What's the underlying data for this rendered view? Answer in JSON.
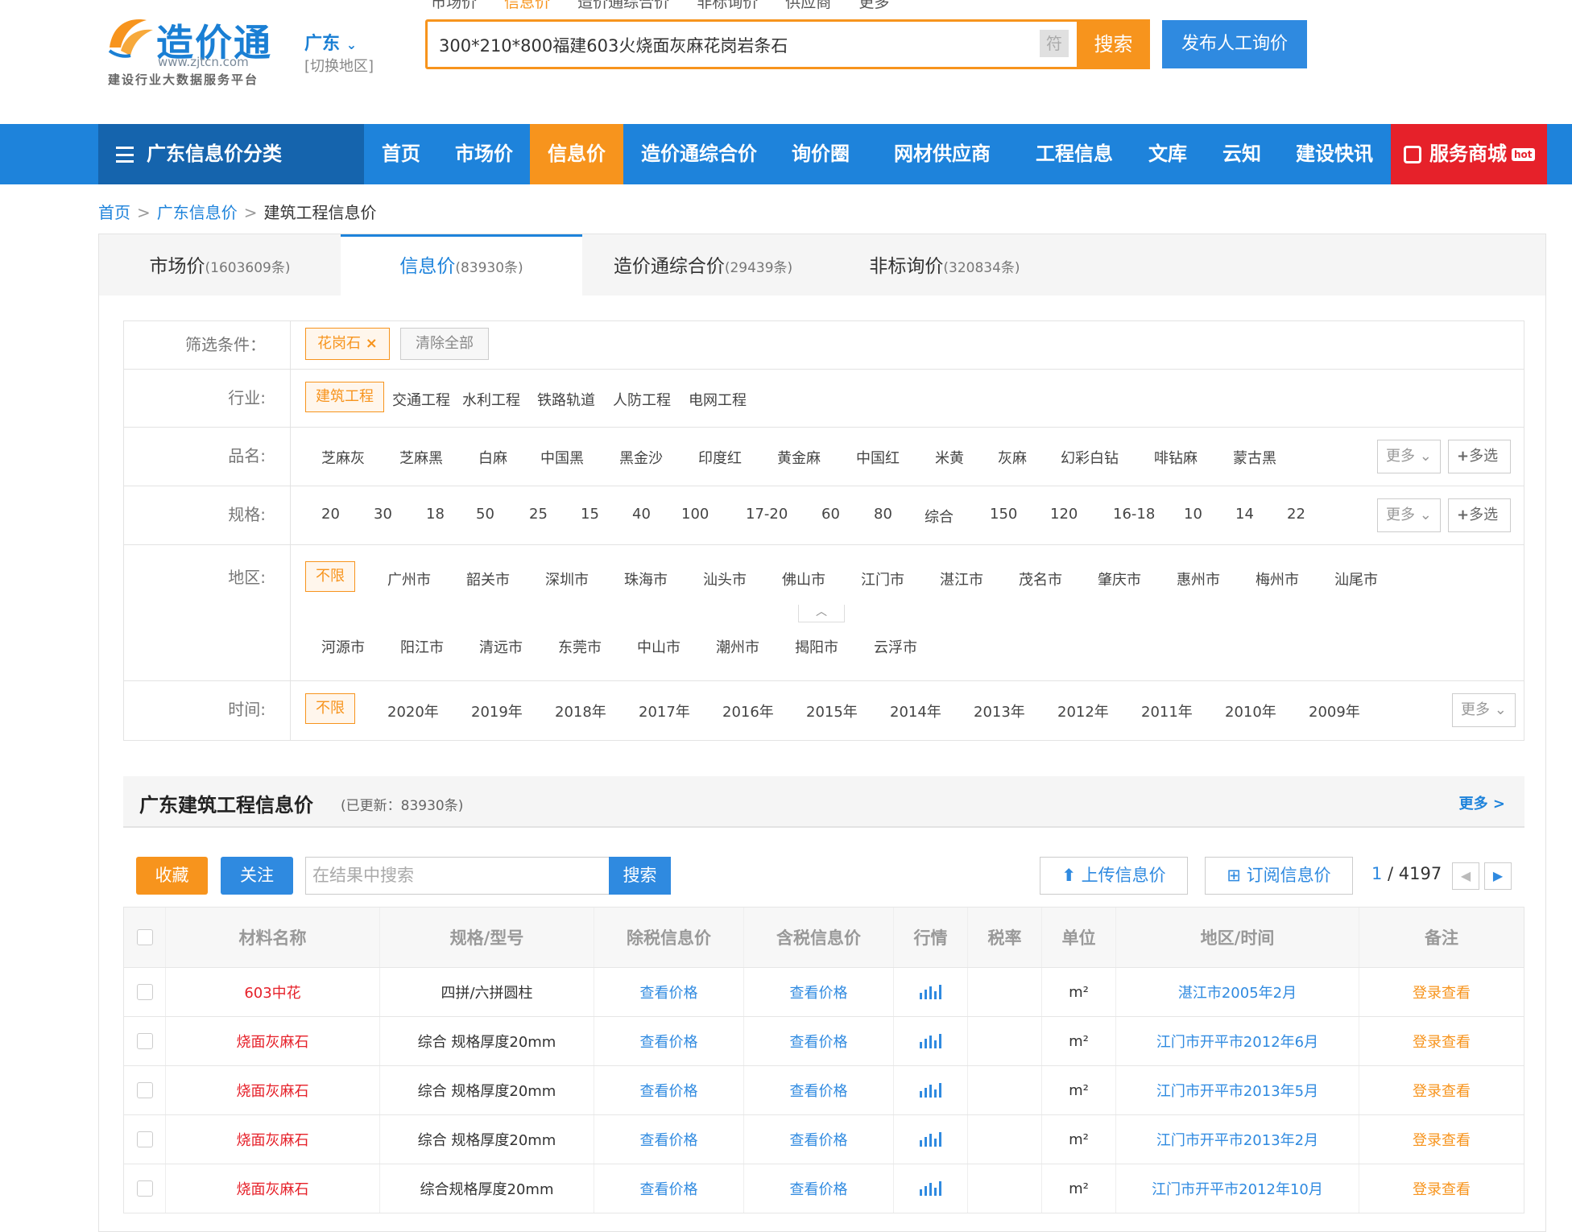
{
  "header": {
    "logo_name": "造价通",
    "logo_url": "www.zjtcn.com",
    "logo_slogan": "建设行业大数据服务平台",
    "region": "广东",
    "region_switch": "[切换地区]",
    "top_links": [
      "市场价",
      "信息价",
      "造价通综合价",
      "非标询价",
      "供应商",
      "更多"
    ],
    "search_query": "300*210*800福建603火烧面灰麻花岗岩条石",
    "symbol_label": "符",
    "search_button": "搜索",
    "publish_button": "发布人工询价"
  },
  "navbar": {
    "category": "广东信息价分类",
    "items": [
      "首页",
      "市场价",
      "信息价",
      "造价通综合价",
      "询价圈",
      "网材供应商",
      "工程信息",
      "文库",
      "云知",
      "建设快讯"
    ],
    "shop": "服务商城",
    "shop_badge": "hot"
  },
  "breadcrumb": [
    "首页",
    "广东信息价",
    "建筑工程信息价"
  ],
  "tabs": [
    {
      "label": "市场价",
      "count": "(1603609条)"
    },
    {
      "label": "信息价",
      "count": "(83930条)"
    },
    {
      "label": "造价通综合价",
      "count": "(29439条)"
    },
    {
      "label": "非标询价",
      "count": "(320834条)"
    }
  ],
  "filters": {
    "condition_label": "筛选条件：",
    "active_tag": "花岗石",
    "clear_all": "清除全部",
    "industry_label": "行业:",
    "industry": [
      "建筑工程",
      "交通工程",
      "水利工程",
      "铁路轨道",
      "人防工程",
      "电网工程"
    ],
    "name_label": "品名:",
    "names": [
      "芝麻灰",
      "芝麻黑",
      "白麻",
      "中国黑",
      "黑金沙",
      "印度红",
      "黄金麻",
      "中国红",
      "米黄",
      "灰麻",
      "幻彩白钻",
      "啡钻麻",
      "蒙古黑"
    ],
    "spec_label": "规格:",
    "specs": [
      "20",
      "30",
      "18",
      "50",
      "25",
      "15",
      "40",
      "100",
      "17-20",
      "60",
      "80",
      "综合",
      "150",
      "120",
      "16-18",
      "10",
      "14",
      "22"
    ],
    "region_label": "地区:",
    "regions_row1": [
      "不限",
      "广州市",
      "韶关市",
      "深圳市",
      "珠海市",
      "汕头市",
      "佛山市",
      "江门市",
      "湛江市",
      "茂名市",
      "肇庆市",
      "惠州市",
      "梅州市",
      "汕尾市"
    ],
    "regions_row2": [
      "河源市",
      "阳江市",
      "清远市",
      "东莞市",
      "中山市",
      "潮州市",
      "揭阳市",
      "云浮市"
    ],
    "time_label": "时间:",
    "times": [
      "不限",
      "2020年",
      "2019年",
      "2018年",
      "2017年",
      "2016年",
      "2015年",
      "2014年",
      "2013年",
      "2012年",
      "2011年",
      "2010年",
      "2009年"
    ],
    "more": "更多",
    "multi": "多选"
  },
  "results": {
    "title": "广东建筑工程信息价",
    "updated": "(已更新：83930条)",
    "more": "更多 >",
    "fav_button": "收藏",
    "follow_button": "关注",
    "search_placeholder": "在结果中搜索",
    "search_button": "搜索",
    "upload_button": "上传信息价",
    "subscribe_button": "订阅信息价",
    "page_current": "1",
    "page_total": " / 4197"
  },
  "table": {
    "columns": [
      "材料名称",
      "规格/型号",
      "除税信息价",
      "含税信息价",
      "行情",
      "税率",
      "单位",
      "地区/时间",
      "备注"
    ],
    "rows": [
      {
        "name": "603中花",
        "spec": "四拼/六拼圆柱",
        "ex_tax": "查看价格",
        "in_tax": "查看价格",
        "rate": "",
        "unit": "m²",
        "region_time": "湛江市2005年2月",
        "note": "登录查看"
      },
      {
        "name": "烧面灰麻石",
        "spec": "综合 规格厚度20mm",
        "ex_tax": "查看价格",
        "in_tax": "查看价格",
        "rate": "",
        "unit": "m²",
        "region_time": "江门市开平市2012年6月",
        "note": "登录查看"
      },
      {
        "name": "烧面灰麻石",
        "spec": "综合 规格厚度20mm",
        "ex_tax": "查看价格",
        "in_tax": "查看价格",
        "rate": "",
        "unit": "m²",
        "region_time": "江门市开平市2013年5月",
        "note": "登录查看"
      },
      {
        "name": "烧面灰麻石",
        "spec": "综合 规格厚度20mm",
        "ex_tax": "查看价格",
        "in_tax": "查看价格",
        "rate": "",
        "unit": "m²",
        "region_time": "江门市开平市2013年2月",
        "note": "登录查看"
      },
      {
        "name": "烧面灰麻石",
        "spec": "综合规格厚度20mm",
        "ex_tax": "查看价格",
        "in_tax": "查看价格",
        "rate": "",
        "unit": "m²",
        "region_time": "江门市开平市2012年10月",
        "note": "登录查看"
      }
    ]
  },
  "colors": {
    "brand_blue": "#1e83db",
    "accent_orange": "#f7941d",
    "shop_red": "#e6212a"
  }
}
